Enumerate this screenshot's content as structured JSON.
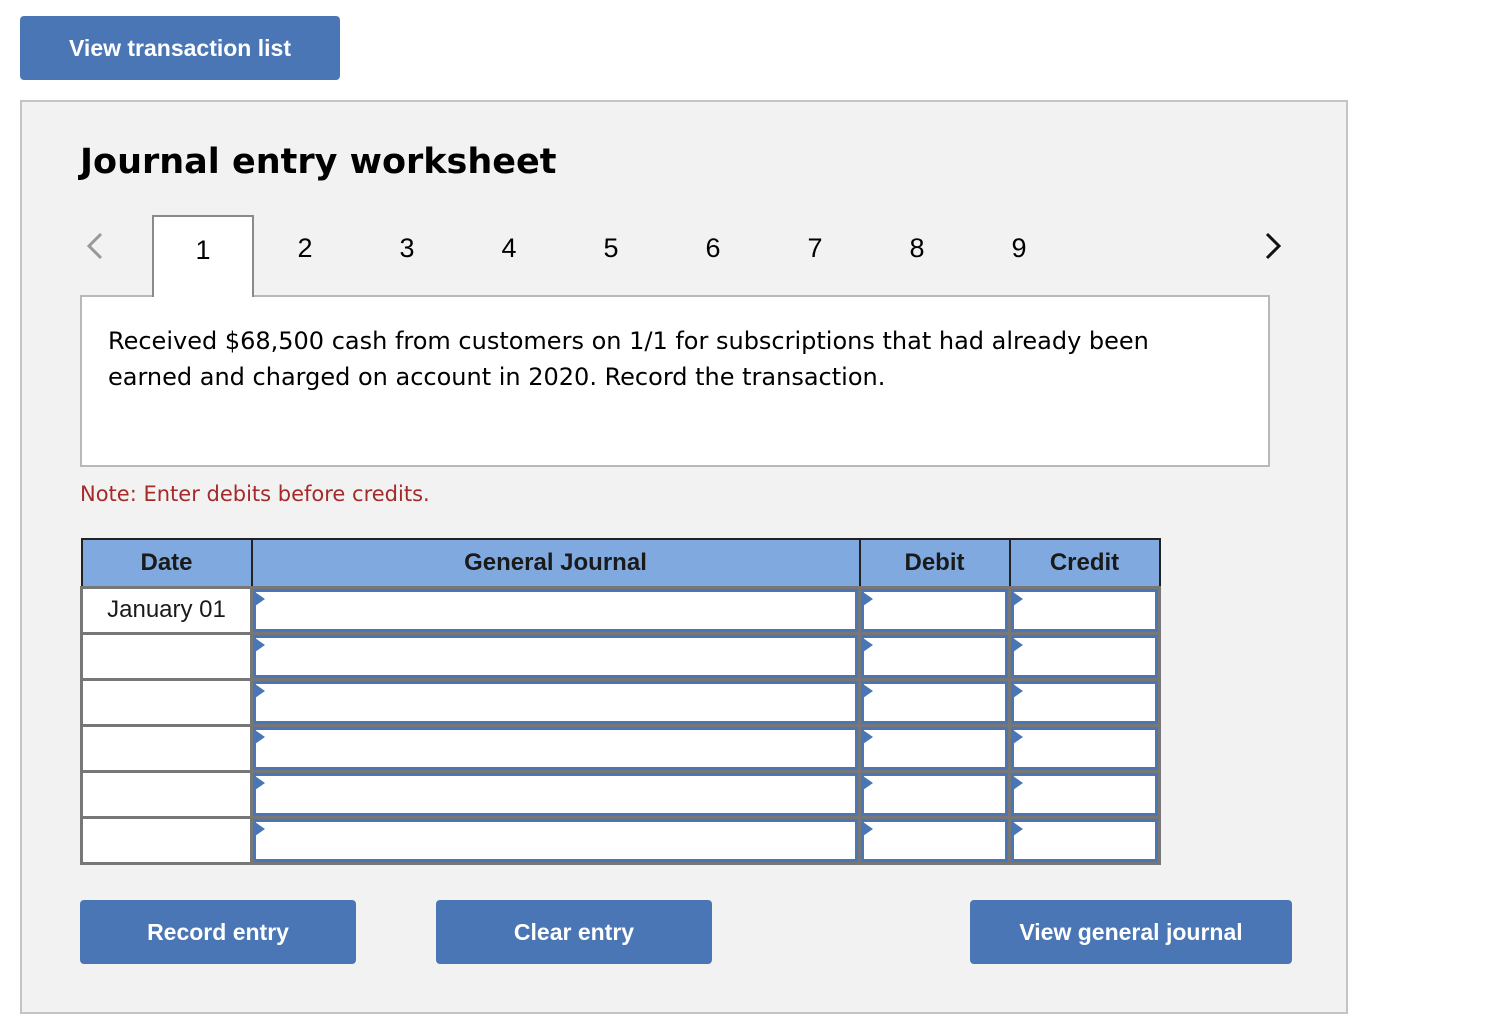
{
  "top_button": {
    "label": "View transaction list"
  },
  "worksheet": {
    "title": "Journal entry worksheet",
    "nav": {
      "prev_icon": "chevron-left-icon",
      "next_icon": "chevron-right-icon"
    },
    "tabs": [
      {
        "label": "1",
        "active": true
      },
      {
        "label": "2",
        "active": false
      },
      {
        "label": "3",
        "active": false
      },
      {
        "label": "4",
        "active": false
      },
      {
        "label": "5",
        "active": false
      },
      {
        "label": "6",
        "active": false
      },
      {
        "label": "7",
        "active": false
      },
      {
        "label": "8",
        "active": false
      },
      {
        "label": "9",
        "active": false
      }
    ],
    "description": "Received $68,500 cash from customers on 1/1 for subscriptions that had already been earned and charged on account in 2020. Record the transaction.",
    "note": "Note: Enter debits before credits.",
    "table": {
      "headers": {
        "date": "Date",
        "journal": "General Journal",
        "debit": "Debit",
        "credit": "Credit"
      },
      "rows": [
        {
          "date": "January 01",
          "journal": "",
          "debit": "",
          "credit": ""
        },
        {
          "date": "",
          "journal": "",
          "debit": "",
          "credit": ""
        },
        {
          "date": "",
          "journal": "",
          "debit": "",
          "credit": ""
        },
        {
          "date": "",
          "journal": "",
          "debit": "",
          "credit": ""
        },
        {
          "date": "",
          "journal": "",
          "debit": "",
          "credit": ""
        },
        {
          "date": "",
          "journal": "",
          "debit": "",
          "credit": ""
        }
      ]
    },
    "buttons": {
      "record": "Record entry",
      "clear": "Clear entry",
      "view_journal": "View general journal"
    }
  },
  "colors": {
    "button_bg": "#4a76b5",
    "header_bg": "#80aadf",
    "note_text": "#a52a2a",
    "panel_bg": "#f2f2f2"
  }
}
